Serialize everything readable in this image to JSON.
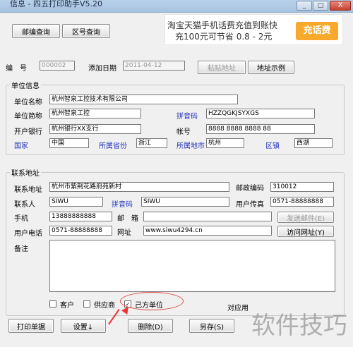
{
  "window": {
    "title": "信息 - 四五打印助手V5.20",
    "minimize": "_",
    "maximize": "□",
    "close": "X"
  },
  "toolbar": {
    "postal_query": "邮编查询",
    "area_code_query": "区号查询"
  },
  "ad": {
    "line1": "淘宝天猫手机话费充值到账快",
    "line2": "充100元可节省 0.8 - 2元",
    "cta": "充话费"
  },
  "record": {
    "number_label": "编　号",
    "number_value": "000002",
    "add_date_label": "添加日期",
    "add_date_value": "2011-04-12",
    "paste_address": "粘贴地址",
    "address_example": "地址示例"
  },
  "unit_info": {
    "legend": "单位信息",
    "name_label": "单位名称",
    "name_value": "杭州智泉工控技术有限公司",
    "short_label": "单位简称",
    "short_value": "杭州智泉工控",
    "pinyin_label": "拼音码",
    "pinyin_value": "HZZQGKJSYXGS",
    "bank_label": "开户银行",
    "bank_value": "杭州银行XX支行",
    "account_label": "帐号",
    "account_value": "8888 8888 8888 88",
    "country_label": "国家",
    "country_value": "中国",
    "province_label": "所属省份",
    "province_value": "浙江",
    "city_label": "所属地市",
    "city_value": "杭州",
    "district_label": "区镇",
    "district_value": "西湖"
  },
  "contact": {
    "legend": "联系地址",
    "address_label": "联系地址",
    "address_value": "杭州市紫荆花路府苑新村",
    "postcode_label": "邮政编码",
    "postcode_value": "310012",
    "person_label": "联系人",
    "person_value": "SIWU",
    "pinyin_label": "拼音码",
    "pinyin_value": "SIWU",
    "fax_label": "用户传真",
    "fax_value": "0571-88888888",
    "mobile_label": "手机",
    "mobile_value": "13888888888",
    "email_label": "邮　箱",
    "email_value": "",
    "send_mail": "发送邮件(E)",
    "phone_label": "用户电话",
    "phone_value": "0571-88888888",
    "website_label": "网址",
    "website_value": "www.siwu4294.cn",
    "visit_site": "访问网址(Y)",
    "notes_label": "备注",
    "notes_value": ""
  },
  "types": {
    "customer": "客户",
    "supplier": "供应商",
    "own_unit": "己方单位",
    "own_checked": "✓"
  },
  "truncated_label": "对应用",
  "bottom": {
    "print_label": "打印单据",
    "settings": "设置↓",
    "delete": "删除(D)",
    "save": "另存(S)"
  },
  "watermark": "软件技巧"
}
